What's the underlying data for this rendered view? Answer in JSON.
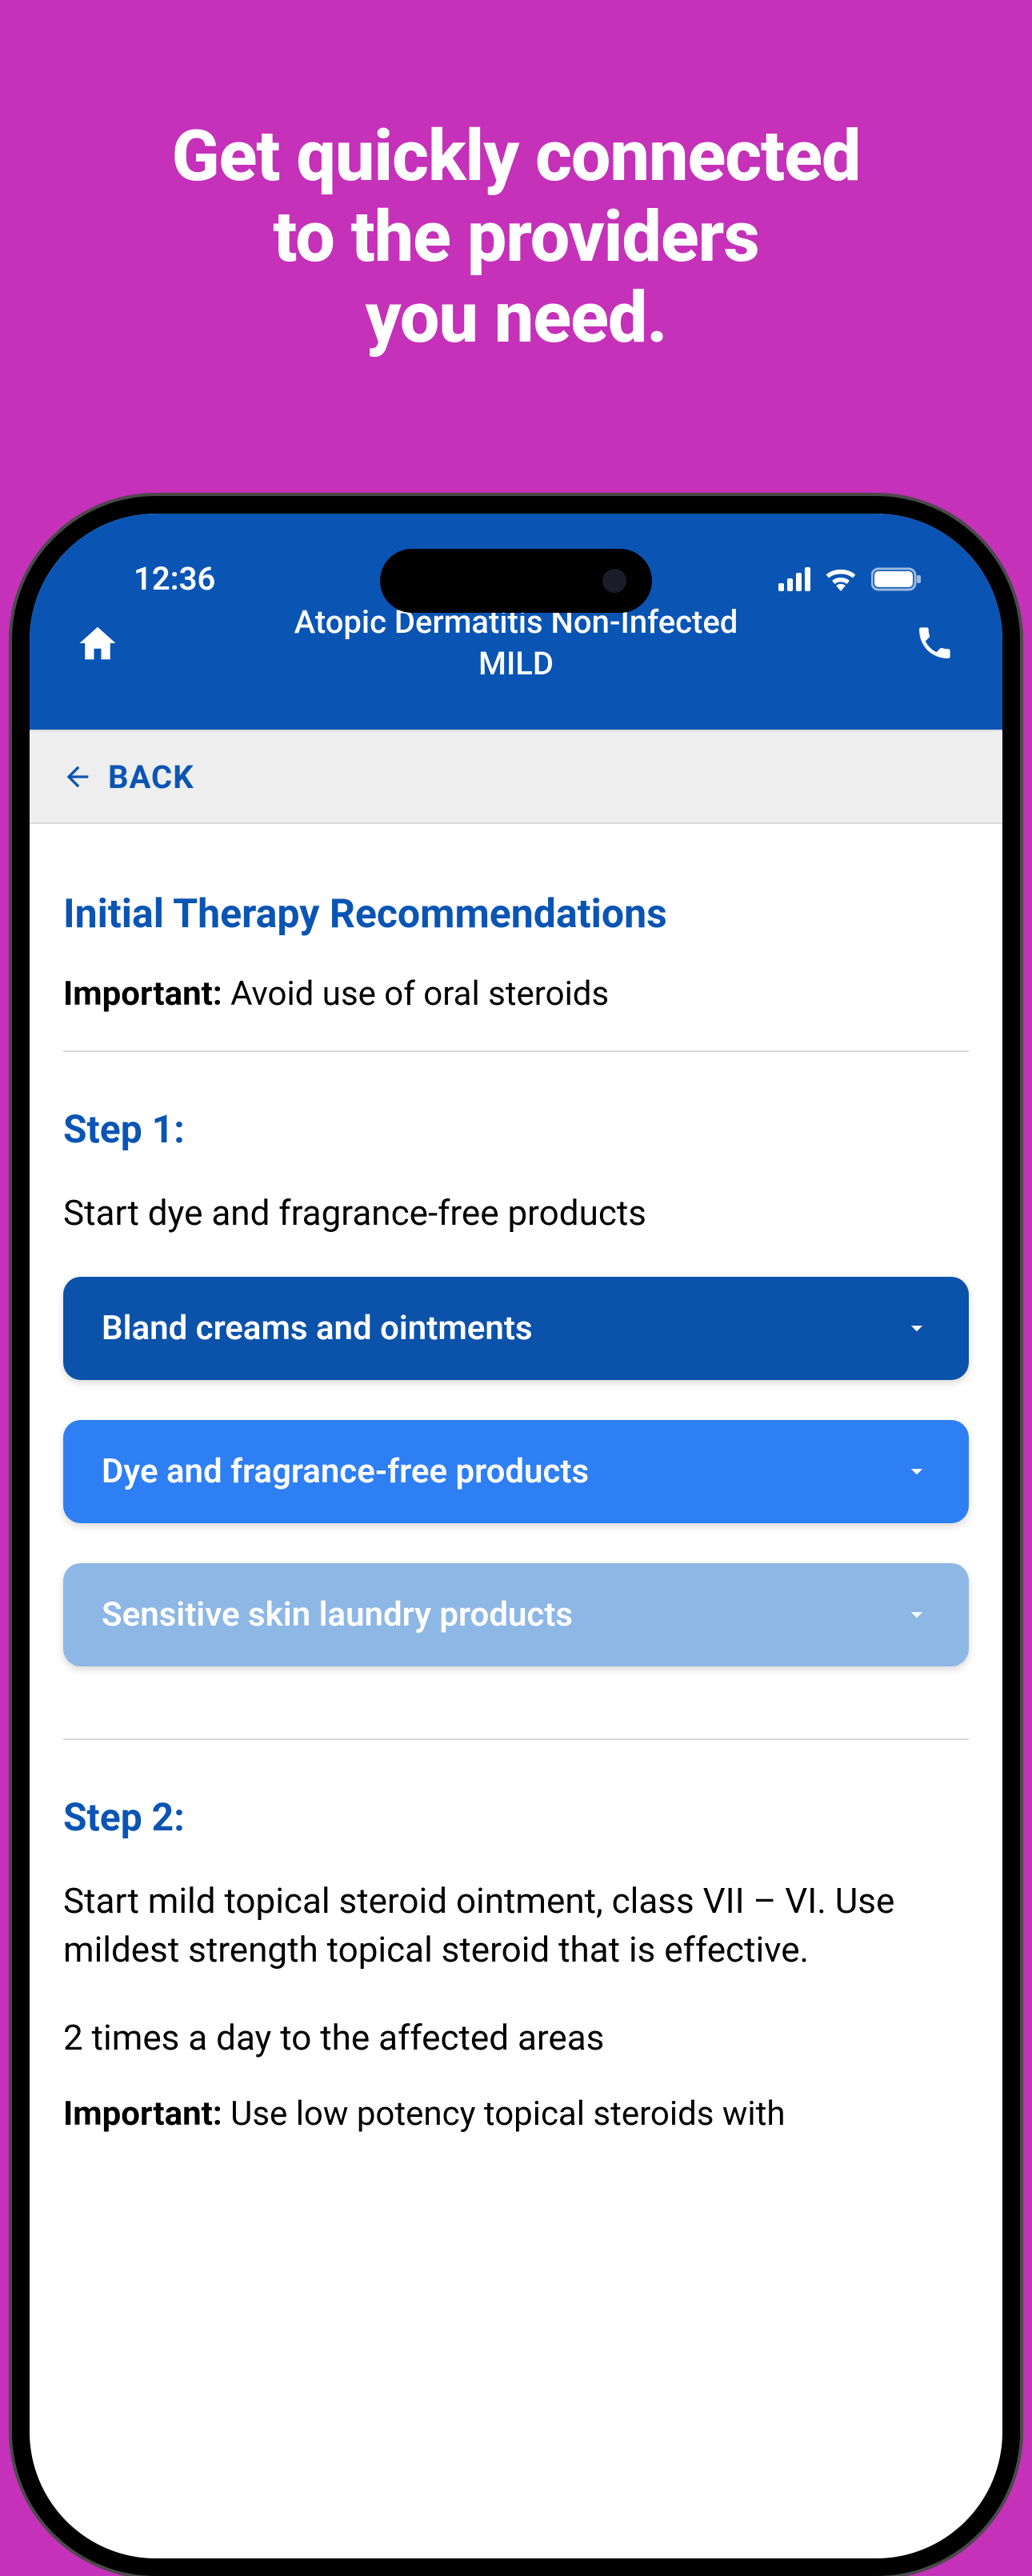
{
  "promo": {
    "line1": "Get quickly connected",
    "line2": "to the providers",
    "line3": "you need."
  },
  "status": {
    "time": "12:36"
  },
  "header": {
    "title_line1": "Atopic Dermatitis Non-Infected",
    "title_line2": "MILD"
  },
  "back": {
    "label": "BACK"
  },
  "main": {
    "heading": "Initial Therapy Recommendations",
    "important_label": "Important:",
    "important_text": " Avoid use of oral steroids"
  },
  "step1": {
    "heading": "Step 1:",
    "desc": "Start dye and fragrance-free products",
    "items": [
      "Bland creams and ointments",
      "Dye and fragrance-free products",
      "Sensitive skin laundry products"
    ]
  },
  "step2": {
    "heading": "Step 2:",
    "desc": "Start mild topical steroid ointment, class VII – VI. Use mildest strength topical steroid that is effective.",
    "dosage": "2 times a day to the affected areas",
    "important_label": "Important:",
    "important_text": " Use low potency topical steroids with"
  }
}
